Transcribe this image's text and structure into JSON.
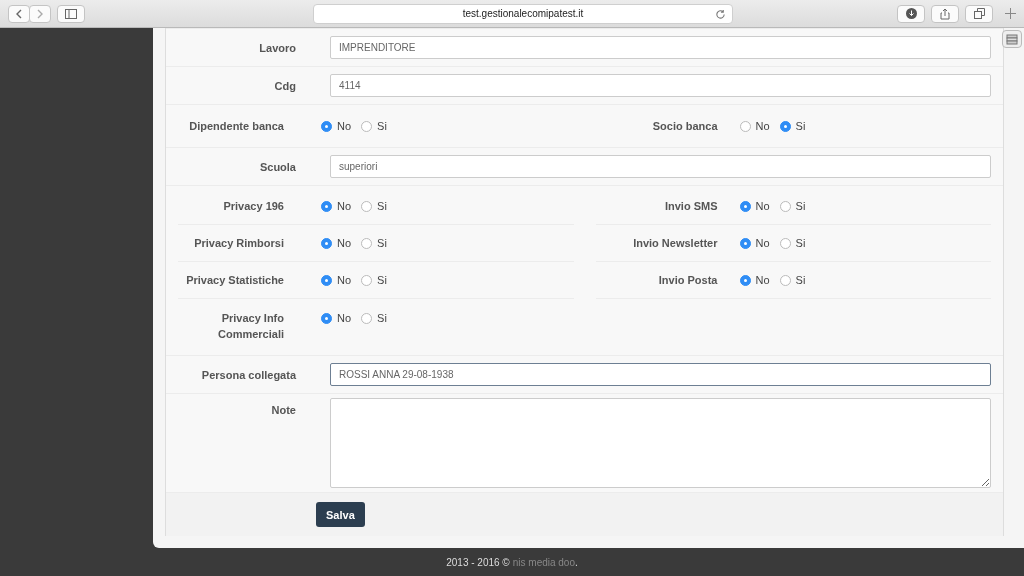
{
  "browser": {
    "url": "test.gestionalecomipatest.it"
  },
  "form": {
    "rows": [
      {
        "kind": "text",
        "label": "Lavoro",
        "value": "IMPRENDITORE",
        "focused": false
      },
      {
        "kind": "text",
        "label": "Cdg",
        "value": "4114",
        "focused": false
      },
      {
        "kind": "radios",
        "pairs": [
          [
            {
              "label": "Dipendente banca",
              "options": [
                {
                  "label": "No",
                  "selected": true
                },
                {
                  "label": "Si",
                  "selected": false
                }
              ]
            },
            {
              "label": "Socio banca",
              "options": [
                {
                  "label": "No",
                  "selected": false
                },
                {
                  "label": "Si",
                  "selected": true
                }
              ]
            }
          ]
        ]
      },
      {
        "kind": "text",
        "label": "Scuola",
        "value": "superiori",
        "focused": false
      },
      {
        "kind": "radios",
        "pairs": [
          [
            {
              "label": "Privacy 196",
              "options": [
                {
                  "label": "No",
                  "selected": true
                },
                {
                  "label": "Si",
                  "selected": false
                }
              ]
            },
            {
              "label": "Invio SMS",
              "options": [
                {
                  "label": "No",
                  "selected": true
                },
                {
                  "label": "Si",
                  "selected": false
                }
              ]
            }
          ],
          [
            {
              "label": "Privacy Rimborsi",
              "options": [
                {
                  "label": "No",
                  "selected": true
                },
                {
                  "label": "Si",
                  "selected": false
                }
              ]
            },
            {
              "label": "Invio Newsletter",
              "options": [
                {
                  "label": "No",
                  "selected": true
                },
                {
                  "label": "Si",
                  "selected": false
                }
              ]
            }
          ],
          [
            {
              "label": "Privacy Statistiche",
              "options": [
                {
                  "label": "No",
                  "selected": true
                },
                {
                  "label": "Si",
                  "selected": false
                }
              ]
            },
            {
              "label": "Invio Posta",
              "options": [
                {
                  "label": "No",
                  "selected": true
                },
                {
                  "label": "Si",
                  "selected": false
                }
              ]
            }
          ],
          [
            {
              "label": "Privacy Info Commerciali",
              "options": [
                {
                  "label": "No",
                  "selected": true
                },
                {
                  "label": "Si",
                  "selected": false
                }
              ]
            }
          ]
        ]
      },
      {
        "kind": "text",
        "label": "Persona collegata",
        "value": "ROSSI ANNA 29-08-1938",
        "focused": true
      },
      {
        "kind": "textarea",
        "label": "Note"
      }
    ],
    "submit": "Salva"
  },
  "footer": {
    "text": "2013 - 2016 ©",
    "link": "nis media doo",
    "end": "."
  }
}
